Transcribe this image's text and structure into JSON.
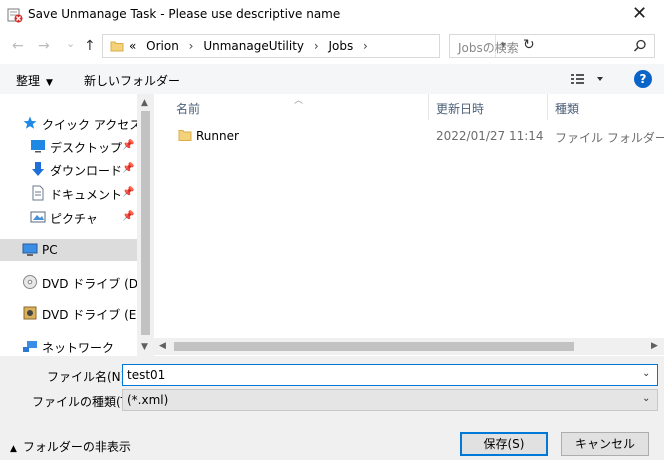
{
  "window": {
    "title": "Save Unmanage Task - Please use descriptive name",
    "close_glyph": "✕"
  },
  "navigation": {
    "back": "←",
    "forward": "→",
    "recent": "⌄",
    "up": "↑",
    "breadcrumb_prefix": "«",
    "breadcrumbs": [
      "Orion",
      "UnmanageUtility",
      "Jobs"
    ],
    "refresh": "↻",
    "search_placeholder": "Jobsの検索"
  },
  "toolbar": {
    "organize": "整理",
    "new_folder": "新しいフォルダー"
  },
  "sidebar": {
    "items": [
      {
        "label": "クイック アクセス",
        "icon": "star-icon"
      },
      {
        "label": "デスクトップ",
        "icon": "desktop-icon",
        "pinned": true
      },
      {
        "label": "ダウンロード",
        "icon": "download-icon",
        "pinned": true
      },
      {
        "label": "ドキュメント",
        "icon": "document-icon",
        "pinned": true
      },
      {
        "label": "ピクチャ",
        "icon": "picture-icon",
        "pinned": true
      },
      {
        "label": "PC",
        "icon": "pc-icon",
        "selected": true
      },
      {
        "label": "DVD ドライブ (D:) O",
        "icon": "dvd-icon"
      },
      {
        "label": "DVD ドライブ (E:) Sc",
        "icon": "dvd-icon"
      },
      {
        "label": "ネットワーク",
        "icon": "network-icon"
      }
    ]
  },
  "file_list": {
    "columns": [
      "名前",
      "更新日時",
      "種類"
    ],
    "rows": [
      {
        "name": "Runner",
        "modified": "2022/01/27 11:14",
        "type": "ファイル フォルダー"
      }
    ]
  },
  "form": {
    "filename_label": "ファイル名(N):",
    "filename_value": "test01",
    "filetype_label": "ファイルの種類(T):",
    "filetype_value": "(*.xml)"
  },
  "footer": {
    "hide_folders": "フォルダーの非表示",
    "save": "保存(S)",
    "cancel": "キャンセル"
  }
}
